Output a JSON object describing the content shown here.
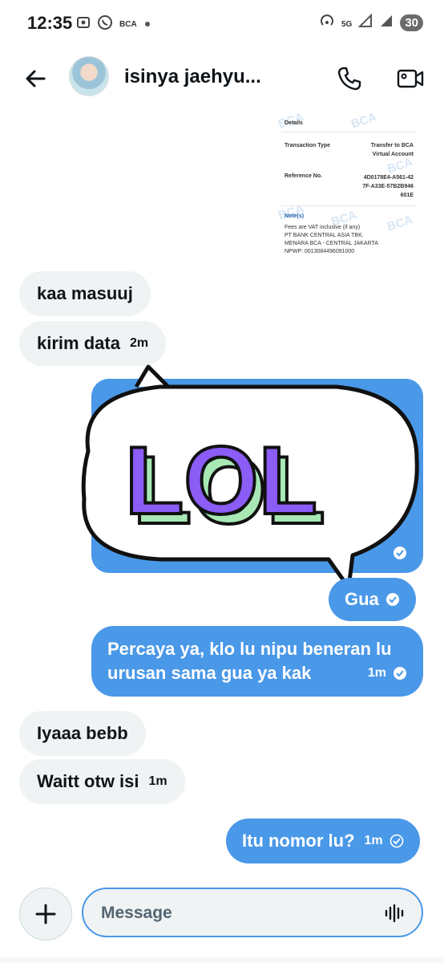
{
  "status_bar": {
    "time": "12:35",
    "left_icons": [
      "screenshot-icon",
      "whatsapp-icon",
      "bca-icon",
      "dot-icon"
    ],
    "bca_label": "BCA",
    "network_label": "5G",
    "battery": "30"
  },
  "header": {
    "contact_name": "isinya jaehyu..."
  },
  "receipt": {
    "details_label": "Details",
    "transaction_type_label": "Transaction Type",
    "transaction_type_value_1": "Transfer to BCA",
    "transaction_type_value_2": "Virtual Account",
    "reference_label": "Reference No.",
    "reference_value_1": "4D0178E4-A561-42",
    "reference_value_2": "7F-A33E-57B2B946",
    "reference_value_3": "601E",
    "note_label": "Note(s)",
    "note_1": "Fees are VAT inclusive (if any)",
    "note_2": "PT BANK CENTRAL ASIA TBK.",
    "note_3": "MENARA BCA - CENTRAL JAKARTA",
    "note_4": "NPWP: 0013084496091000",
    "watermark": "BCA"
  },
  "messages": [
    {
      "direction": "in",
      "text": "kaa masuuj",
      "time": ""
    },
    {
      "direction": "in",
      "text": "kirim data",
      "time": "2m"
    },
    {
      "direction": "out",
      "text": "Gua",
      "time": ""
    },
    {
      "direction": "out",
      "text_line1": "Percaya ya, klo lu nipu beneran lu",
      "text_line2": "urusan sama gua ya kak",
      "time": "1m"
    },
    {
      "direction": "in",
      "text": "Iyaaa bebb",
      "time": ""
    },
    {
      "direction": "in",
      "text": "Waitt otw isi",
      "time": "1m"
    },
    {
      "direction": "out",
      "text": "Itu nomor lu?",
      "time": "1m"
    }
  ],
  "sticker": {
    "text": "LOL",
    "fill_color": "#8b5cf6",
    "shadow_color": "#a7e8b5"
  },
  "composer": {
    "placeholder": "Message"
  },
  "colors": {
    "outgoing_bubble": "#4a98e8",
    "incoming_bubble": "#eff3f4",
    "accent": "#4a98e8"
  }
}
